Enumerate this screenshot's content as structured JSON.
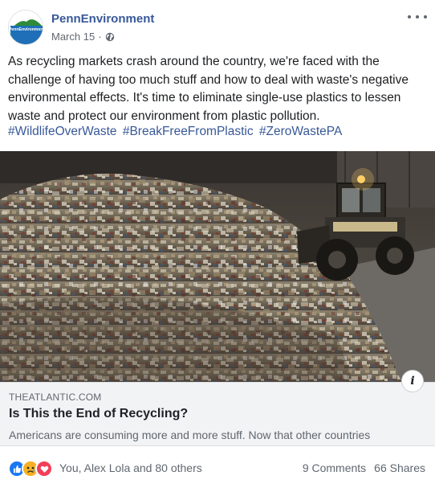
{
  "post": {
    "page_name": "PennEnvironment",
    "date": "March 15",
    "privacy_icon": "globe-icon",
    "avatar_logo_text": "PennEnvironment",
    "text": "As recycling markets crash around the country, we're faced with the challenge of having too much stuff and how to deal with waste's negative environmental effects. It's time to eliminate single-use plastics to lessen waste and protect our environment from plastic pollution.",
    "hashtags": [
      "#WildlifeOverWaste",
      "#BreakFreeFromPlastic",
      "#ZeroWastePA"
    ]
  },
  "link": {
    "domain": "THEATLANTIC.COM",
    "title": "Is This the End of Recycling?",
    "description": "Americans are consuming more and more stuff. Now that other countries",
    "info_icon": "info-icon"
  },
  "footer": {
    "reactions": [
      "like",
      "sad",
      "love"
    ],
    "reaction_names": "You, Alex Lola and 80 others",
    "comments": "9 Comments",
    "shares": "66 Shares"
  },
  "colors": {
    "link_blue": "#385898",
    "meta_gray": "#606770",
    "like_blue": "#1877f2",
    "love_red": "#f33e58",
    "sad_yellow": "#f7b125"
  }
}
